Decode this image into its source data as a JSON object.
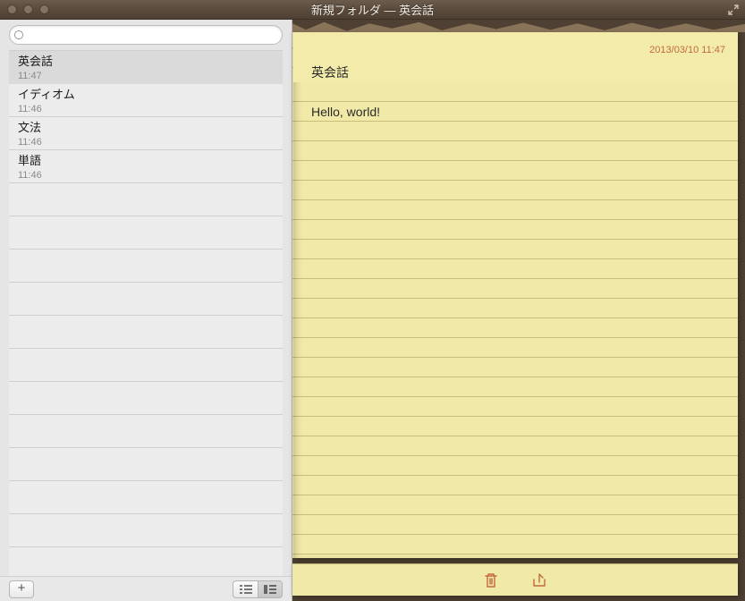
{
  "window": {
    "title": "新規フォルダ — 英会話"
  },
  "search": {
    "placeholder": "",
    "value": ""
  },
  "notes": [
    {
      "title": "英会話",
      "time": "11:47",
      "selected": true
    },
    {
      "title": "イディオム",
      "time": "11:46",
      "selected": false
    },
    {
      "title": "文法",
      "time": "11:46",
      "selected": false
    },
    {
      "title": "単語",
      "time": "11:46",
      "selected": false
    }
  ],
  "footer": {
    "add_label": "+"
  },
  "note": {
    "timestamp": "2013/03/10 11:47",
    "title": "英会話",
    "body": "Hello, world!"
  },
  "colors": {
    "paper": "#f1e9a8",
    "accent": "#c26a3f",
    "titlebar": "#5a4b3c"
  }
}
